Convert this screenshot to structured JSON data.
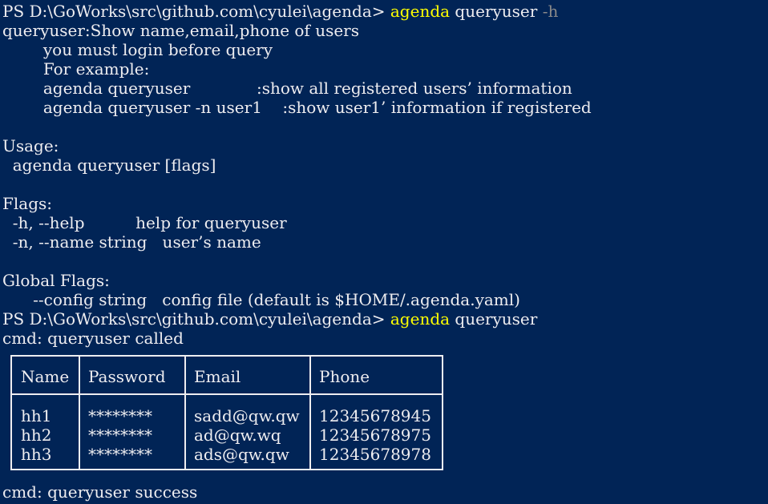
{
  "prompt": "PS D:\\GoWorks\\src\\github.com\\cyulei\\agenda> ",
  "command1": {
    "program": "agenda",
    "args": " queryuser ",
    "flag": "-h"
  },
  "help": {
    "desc": "queryuser:Show name,email,phone of users",
    "note": "        you must login before query",
    "example_header": "        For example:",
    "examples": [
      "        agenda queryuser             :show all registered users’ information",
      "        agenda queryuser -n user1    :show user1’ information if registered"
    ],
    "usage_header": "Usage:",
    "usage": "  agenda queryuser [flags]",
    "flags_header": "Flags:",
    "flags": [
      "  -h, --help          help for queryuser",
      "  -n, --name string   user’s name"
    ],
    "global_header": "Global Flags:",
    "global_flags": [
      "      --config string   config file (default is $HOME/.agenda.yaml)"
    ]
  },
  "command2": {
    "program": "agenda",
    "args": " queryuser"
  },
  "called": "cmd: queryuser called",
  "table": {
    "headers": [
      "Name",
      "Password",
      "Email",
      "Phone"
    ],
    "rows": [
      [
        "hh1",
        "********",
        "sadd@qw.qw",
        "12345678945"
      ],
      [
        "hh2",
        "********",
        "ad@qw.wq",
        "12345678975"
      ],
      [
        "hh3",
        "********",
        "ads@qw.qw",
        "12345678978"
      ]
    ]
  },
  "success": "cmd: queryuser success",
  "colors": {
    "background": "#012456",
    "text": "#eeedf0",
    "command": "#ffff00",
    "parameter": "#8a8a8a"
  }
}
